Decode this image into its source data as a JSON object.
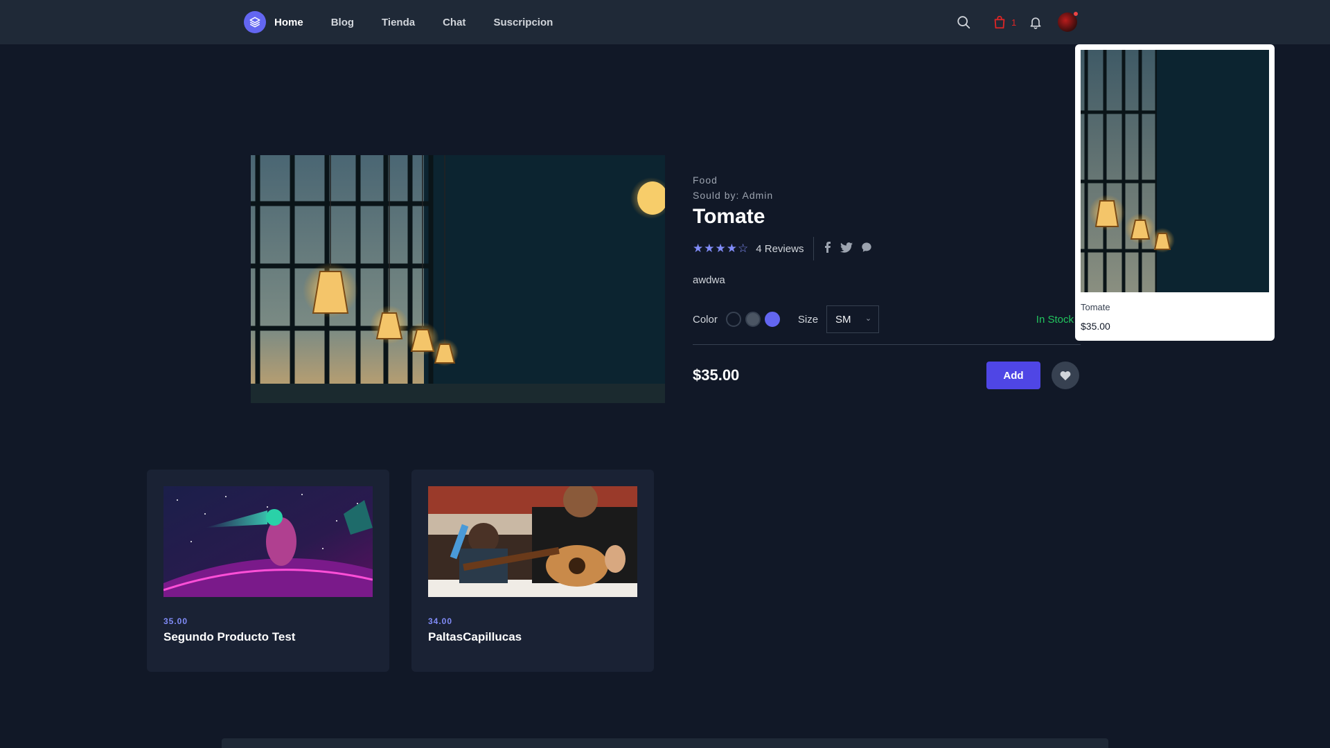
{
  "nav": {
    "links": [
      "Home",
      "Blog",
      "Tienda",
      "Chat",
      "Suscripcion"
    ],
    "cart_count": "1"
  },
  "product": {
    "category": "Food",
    "seller": "Sould by: Admin",
    "title": "Tomate",
    "rating": 4,
    "reviews": "4 Reviews",
    "description": "awdwa",
    "color_label": "Color",
    "colors": [
      "#111827",
      "#4b5563",
      "#6366f1"
    ],
    "size_label": "Size",
    "size_value": "SM",
    "stock": "In Stock",
    "price": "$35.00",
    "add_label": "Add"
  },
  "cart_popup": {
    "name": "Tomate",
    "price": "$35.00"
  },
  "related": [
    {
      "price": "35.00",
      "title": "Segundo Producto Test"
    },
    {
      "price": "34.00",
      "title": "PaltasCapillucas"
    }
  ]
}
